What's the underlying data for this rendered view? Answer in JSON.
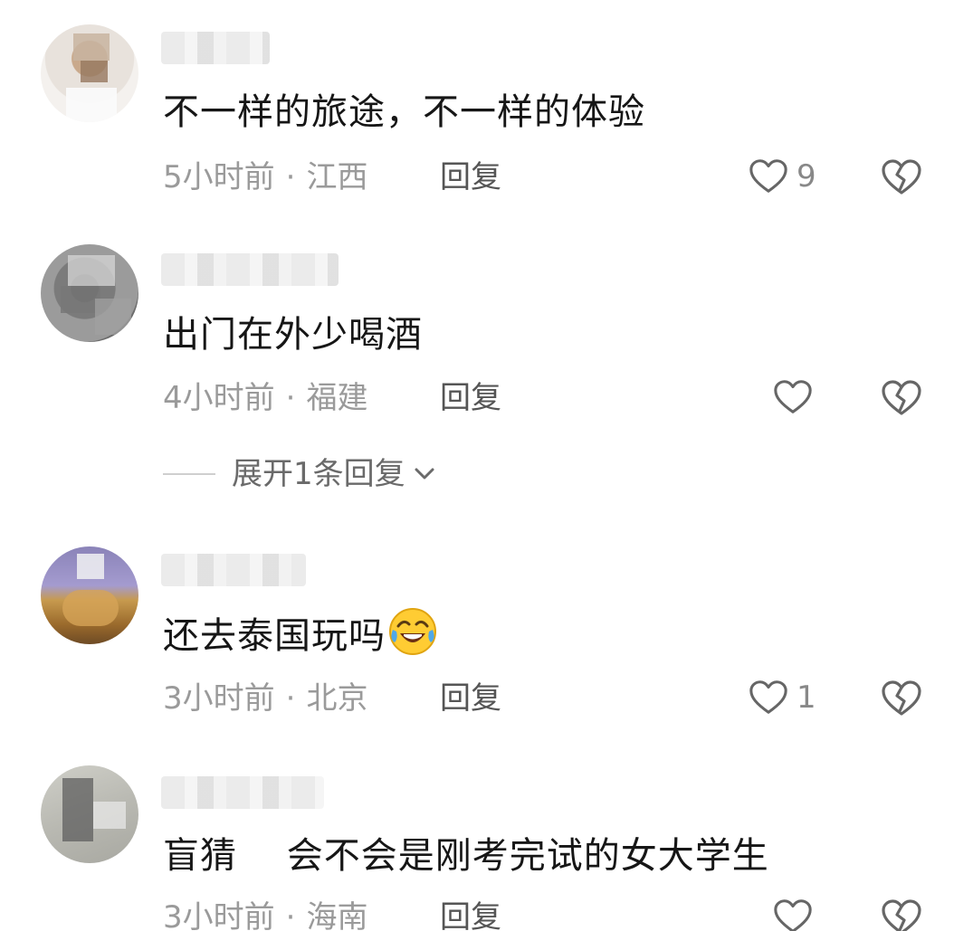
{
  "comments": [
    {
      "text": "不一样的旅途，不一样的体验",
      "time": "5小时前",
      "separator": "·",
      "location": "江西",
      "reply_label": "回复",
      "like_count": "9",
      "avatar_icon": "blurred-avatar"
    },
    {
      "text": "出门在外少喝酒",
      "time": "4小时前",
      "separator": "·",
      "location": "福建",
      "reply_label": "回复",
      "like_count": "",
      "avatar_icon": "blurred-avatar",
      "expand_label": "展开1条回复"
    },
    {
      "text": "还去泰国玩吗",
      "emoji": "laughing-tears-emoji",
      "time": "3小时前",
      "separator": "·",
      "location": "北京",
      "reply_label": "回复",
      "like_count": "1",
      "avatar_icon": "blurred-avatar"
    },
    {
      "text": "盲猜　 会不会是刚考完试的女大学生",
      "time": "3小时前",
      "separator": "·",
      "location": "海南",
      "reply_label": "回复",
      "like_count": "",
      "avatar_icon": "blurred-avatar"
    }
  ],
  "colors": {
    "text": "#161616",
    "meta": "#9a9a9a",
    "icon": "#666666"
  }
}
